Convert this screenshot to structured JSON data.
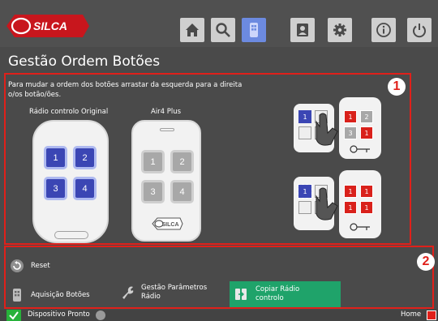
{
  "header": {
    "logo_text": "SILCA",
    "nav": [
      {
        "icon": "home-icon"
      },
      {
        "icon": "search-icon"
      },
      {
        "icon": "remote-icon",
        "active": true
      },
      {
        "icon": "user-icon"
      },
      {
        "icon": "gear-icon"
      },
      {
        "icon": "info-icon"
      },
      {
        "icon": "power-icon"
      }
    ]
  },
  "page_title": "Gestão Ordem Botões",
  "panel1": {
    "marker": "1",
    "instructions": "Para mudar a ordem dos botões arrastar da esquerda para a direita o/os botão/ões.",
    "original_label": "Rádio controlo Original",
    "original_buttons": [
      "1",
      "2",
      "3",
      "4"
    ],
    "target_label": "Air4 Plus",
    "target_buttons": [
      "1",
      "2",
      "3",
      "4"
    ],
    "target_logo": "SILCA",
    "diagram_top": {
      "source": [
        "1",
        ""
      ],
      "target": [
        "1",
        "2",
        "3",
        "1"
      ]
    },
    "diagram_bottom": {
      "source": [
        "1",
        ""
      ],
      "target": [
        "1",
        "1",
        "1",
        "1"
      ]
    }
  },
  "panel2": {
    "marker": "2",
    "reset_label": "Reset",
    "acquire_label": "Aquisição Botões",
    "params_label": "Gestão Parâmetros Rádio",
    "copy_label": "Copiar Rádio controlo"
  },
  "status": {
    "device": "Dispositivo Pronto",
    "home": "Home"
  },
  "colors": {
    "accent_red": "#e0201a",
    "remote_blue": "#3b46b4",
    "copy_green": "#1fa36a",
    "status_green": "#27b13a"
  }
}
